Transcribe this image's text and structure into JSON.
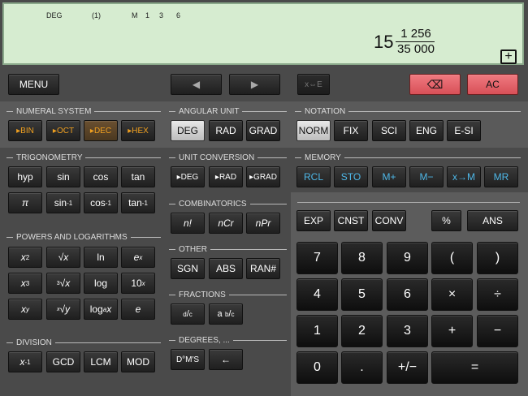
{
  "display": {
    "indicators": [
      {
        "name": "angle-mode-indicator",
        "text": "DEG"
      },
      {
        "name": "paren-indicator",
        "text": "(1)"
      },
      {
        "name": "memory-indicator",
        "text": "M"
      },
      {
        "name": "memory-digit-1",
        "text": "1"
      },
      {
        "name": "memory-digit-3",
        "text": "3"
      },
      {
        "name": "memory-digit-6",
        "text": "6"
      }
    ],
    "result_integer": "15",
    "result_numerator": "1 256",
    "result_denominator": "35 000",
    "expand_symbol": "+"
  },
  "top": {
    "menu": "MENU",
    "left_arrow": "◀",
    "right_arrow": "▶",
    "swap": "x⇔E",
    "backspace": "⌫",
    "ac": "AC"
  },
  "sections": {
    "numeral": "NUMERAL SYSTEM",
    "angular": "ANGULAR UNIT",
    "notation": "NOTATION",
    "trig": "TRIGONOMETRY",
    "unitconv": "UNIT CONVERSION",
    "memory": "MEMORY",
    "combin": "COMBINATORICS",
    "powers": "POWERS AND LOGARITHMS",
    "other": "OTHER",
    "fractions": "FRACTIONS",
    "division": "DIVISION",
    "degrees": "DEGREES, ..."
  },
  "buttons": {
    "bin": "▸BIN",
    "oct": "▸OCT",
    "dec": "▸DEC",
    "hex": "▸HEX",
    "deg": "DEG",
    "rad": "RAD",
    "grad": "GRAD",
    "norm": "NORM",
    "fix": "FIX",
    "sci": "SCI",
    "eng": "ENG",
    "esi": "E-SI",
    "hyp": "hyp",
    "sin": "sin",
    "cos": "cos",
    "tan": "tan",
    "pi": "π",
    "asin": "sin",
    "acos": "cos",
    "atan": "tan",
    "inv": "-1",
    "to_deg": "▸DEG",
    "to_rad": "▸RAD",
    "to_grad": "▸GRAD",
    "rcl": "RCL",
    "sto": "STO",
    "mplus": "M+",
    "mminus": "M−",
    "xtom": "x→M",
    "mr": "MR",
    "fact": "n!",
    "ncr": "nCr",
    "npr": "nPr",
    "x2_base": "x",
    "x2_exp": "2",
    "sqrt": "√x",
    "ln": "ln",
    "ex_base": "e",
    "ex_exp": "x",
    "x3_base": "x",
    "x3_exp": "3",
    "cbrt_pre": "3",
    "cbrt": "√x",
    "log": "log",
    "tenx_base": "10",
    "tenx_exp": "x",
    "xy_base": "x",
    "xy_exp": "y",
    "yroot_pre": "x",
    "yroot": "√y",
    "loga_pre": "log",
    "loga_sub": "a",
    "loga_post": " x",
    "e": "e",
    "sgn": "SGN",
    "abs": "ABS",
    "ran": "RAN#",
    "frac_d": "d",
    "frac_c": "c",
    "frac_a": "a",
    "frac_b": "b",
    "frac_c2": "c",
    "xinv_base": "x",
    "xinv_exp": "-1",
    "gcd": "GCD",
    "lcm": "LCM",
    "mod": "MOD",
    "dms": "D°M′S",
    "back": "←",
    "exp": "EXP",
    "cnst": "CNST",
    "conv": "CONV",
    "percent": "%",
    "ans": "ANS",
    "k7": "7",
    "k8": "8",
    "k9": "9",
    "lparen": "(",
    "rparen": ")",
    "k4": "4",
    "k5": "5",
    "k6": "6",
    "mul": "×",
    "div": "÷",
    "k1": "1",
    "k2": "2",
    "k3": "3",
    "add": "+",
    "sub": "−",
    "k0": "0",
    "dot": ".",
    "neg": "+/−",
    "eq": "="
  },
  "colors": {
    "display_bg": "#d6ecd0",
    "accent_orange": "#f0a020",
    "accent_blue": "#4fb8e8",
    "delete_red": "#e8666e"
  }
}
